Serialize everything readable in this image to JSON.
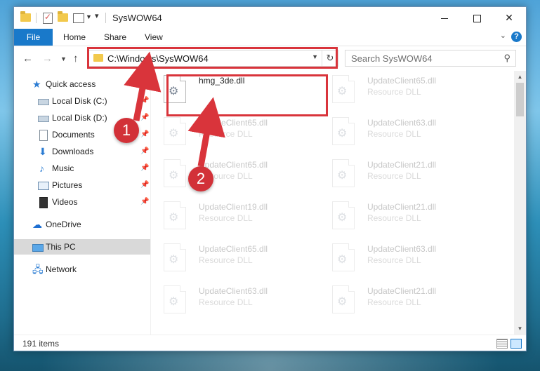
{
  "window": {
    "title": "SysWOW64",
    "controls": {
      "minimize": "",
      "maximize": "",
      "close": "✕"
    }
  },
  "ribbon": {
    "tabs": [
      {
        "label": "File",
        "active": true
      },
      {
        "label": "Home"
      },
      {
        "label": "Share"
      },
      {
        "label": "View"
      }
    ],
    "help": "?"
  },
  "address": {
    "path": "C:\\Windows\\SysWOW64",
    "search_placeholder": "Search SysWOW64"
  },
  "nav": {
    "items": [
      {
        "label": "Quick access"
      },
      {
        "label": "Local Disk (C:)",
        "pinned": true
      },
      {
        "label": "Local Disk (D:)",
        "pinned": true
      },
      {
        "label": "Documents",
        "pinned": true
      },
      {
        "label": "Downloads",
        "pinned": true
      },
      {
        "label": "Music",
        "pinned": true
      },
      {
        "label": "Pictures",
        "pinned": true
      },
      {
        "label": "Videos",
        "pinned": true
      },
      {
        "label": "OneDrive"
      },
      {
        "label": "This PC",
        "selected": true
      },
      {
        "label": "Network"
      }
    ]
  },
  "files": {
    "type_label": "Resource DLL",
    "items": [
      {
        "name": "hmg_3de.dll",
        "type": ""
      },
      {
        "name": "UpdateClient65.dll",
        "type": "Resource DLL"
      },
      {
        "name": "UpdateClient65.dll",
        "type": "Resource DLL"
      },
      {
        "name": "UpdateClient63.dll",
        "type": "Resource DLL"
      },
      {
        "name": "UpdateClient65.dll",
        "type": "Resource DLL"
      },
      {
        "name": "UpdateClient21.dll",
        "type": "Resource DLL"
      },
      {
        "name": "UpdateClient19.dll",
        "type": "Resource DLL"
      },
      {
        "name": "UpdateClient21.dll",
        "type": "Resource DLL"
      },
      {
        "name": "UpdateClient65.dll",
        "type": "Resource DLL"
      },
      {
        "name": "UpdateClient63.dll",
        "type": "Resource DLL"
      },
      {
        "name": "UpdateClient63.dll",
        "type": "Resource DLL"
      },
      {
        "name": "UpdateClient21.dll",
        "type": "Resource DLL"
      }
    ]
  },
  "status": {
    "item_count": "191 items"
  },
  "annotations": {
    "step1": "1",
    "step2": "2",
    "color": "#d9343b"
  }
}
